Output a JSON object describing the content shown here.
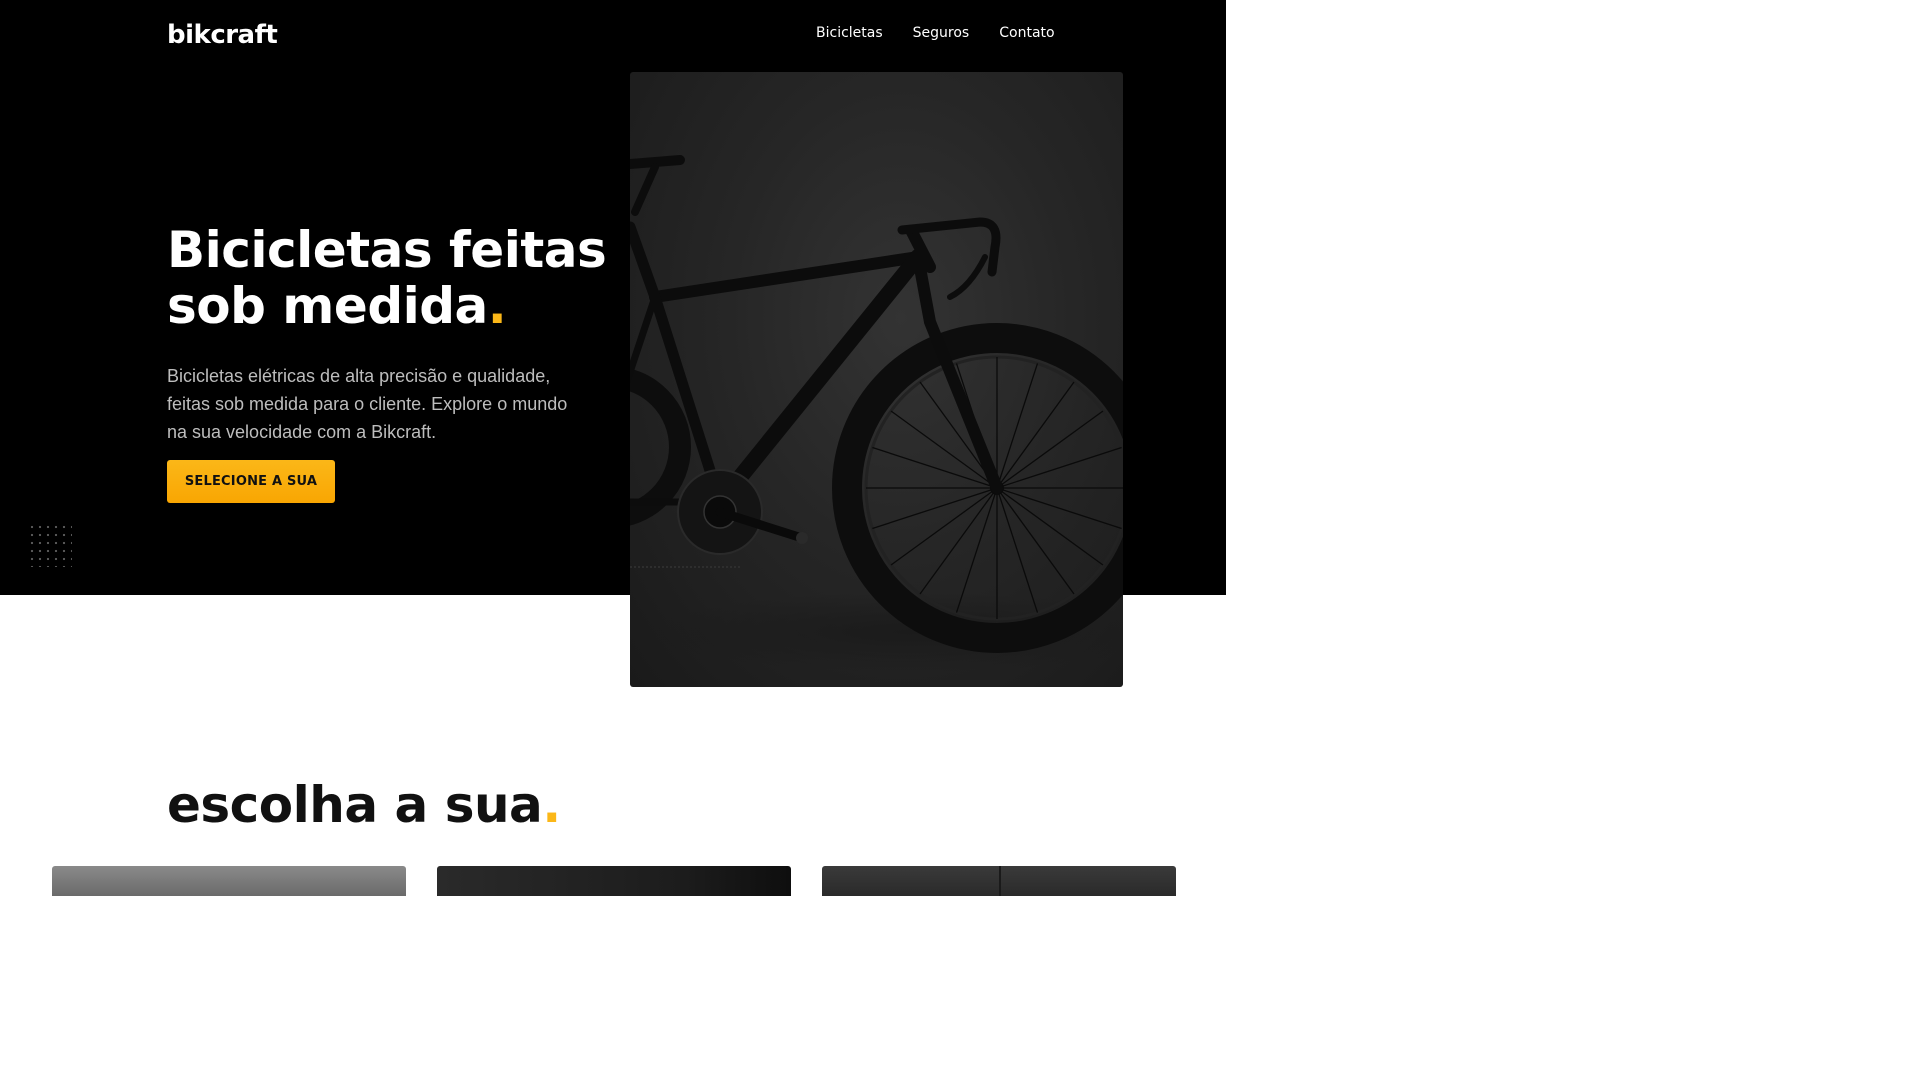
{
  "header": {
    "logo": "bikcraft",
    "nav": [
      {
        "label": "Bicicletas"
      },
      {
        "label": "Seguros"
      },
      {
        "label": "Contato"
      }
    ]
  },
  "hero": {
    "title_line1": "Bicicletas feitas",
    "title_line2": "sob medida",
    "title_dot": ".",
    "description": "Bicicletas elétricas de alta precisão e qualidade, feitas sob medida para o cliente. Explore o mundo na sua velocidade com a Bikcraft.",
    "cta_label": "SELECIONE A SUA"
  },
  "products": {
    "title": "escolha a sua",
    "title_dot": "."
  },
  "colors": {
    "accent": "#fbb718",
    "hero_background": "#000000"
  }
}
